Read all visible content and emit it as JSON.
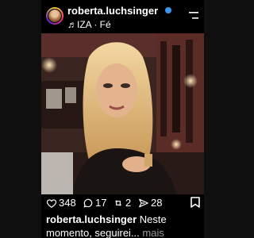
{
  "post": {
    "username": "roberta.luchsinger",
    "music": "♬IZA · Fé",
    "actions": {
      "likes": "348",
      "comments": "17",
      "reposts": "2",
      "shares": "28"
    },
    "caption": {
      "username": "roberta.luchsinger",
      "line1": "Neste",
      "line2": "momento, seguirei...",
      "more": "mais"
    }
  },
  "icons": {
    "verified": "verified-badge",
    "menu": "menu-icon",
    "like": "heart-icon",
    "comment": "comment-icon",
    "repost": "repost-icon",
    "share": "send-icon",
    "bookmark": "bookmark-icon",
    "mute": "speaker-muted-icon"
  },
  "colors": {
    "background": "#000000",
    "verified": "#3897f0",
    "muted_text": "#9a9a9a"
  }
}
